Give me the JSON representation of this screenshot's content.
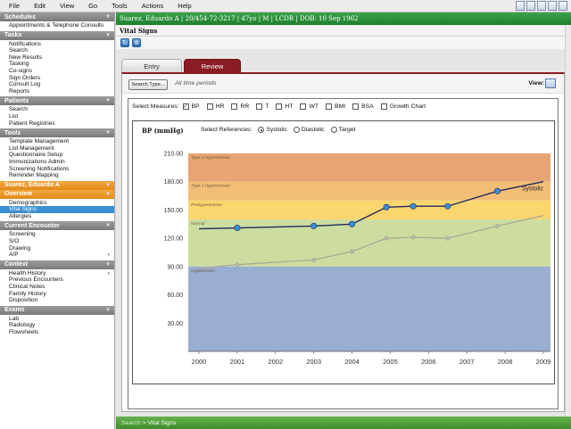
{
  "menubar": {
    "items": [
      "File",
      "Edit",
      "View",
      "Go",
      "Tools",
      "Actions",
      "Help"
    ],
    "right_icons": [
      "calendar-icon",
      "grid-icon",
      "print-icon",
      "list-icon",
      "window-icon"
    ]
  },
  "sidebar": {
    "sections": [
      {
        "title": "Schedules",
        "style": "gray",
        "items": [
          "Appointments & Telephone Consults"
        ]
      },
      {
        "title": "Tasks",
        "style": "gray",
        "items": [
          "Notifications",
          "Search",
          "New Results",
          "Tasking",
          "Co-signs",
          "Sign Orders",
          "Consult Log",
          "Reports"
        ]
      },
      {
        "title": "Patients",
        "style": "gray",
        "items": [
          "Search",
          "List",
          "Patient Registries"
        ]
      },
      {
        "title": "Tools",
        "style": "gray",
        "items": [
          "Template Management",
          "List Management",
          "Questionnaire Setup",
          "Immunizations Admin",
          "Screening Notifications",
          "Reminder Mapping"
        ]
      },
      {
        "title": "Suarez, Eduardo A",
        "style": "orange",
        "items": []
      },
      {
        "title": "Overview",
        "style": "orange",
        "items": [
          "Demographics",
          "Vital Signs",
          "Allergies"
        ],
        "selected": "Vital Signs"
      },
      {
        "title": "Current Encounter",
        "style": "gray",
        "items": [
          "Screening",
          "S/O",
          "Drawing",
          "A/P"
        ],
        "submenu": [
          "A/P"
        ]
      },
      {
        "title": "Context",
        "style": "gray",
        "items": [
          "Health History",
          "Previous Encounters",
          "Clinical Notes",
          "Family History",
          "Disposition"
        ],
        "submenu": [
          "Health History"
        ]
      },
      {
        "title": "Exams",
        "style": "gray",
        "items": [
          "Lab",
          "Radiology",
          "Flowsheets"
        ]
      }
    ]
  },
  "patient_bar": "Suarez, Eduardo A | 20/454-72-3217 | 47yo | M | LCDR | DOB: 10 Sep 1962",
  "subhead": "Vital Signs",
  "tabs": {
    "entry": "Entry",
    "review": "Review"
  },
  "filter": {
    "search_type": "Search Type...",
    "period": "All time periods",
    "view_label": "View:"
  },
  "measures": {
    "label": "Select Measures:",
    "options": [
      {
        "label": "BP",
        "checked": true
      },
      {
        "label": "HR",
        "checked": false
      },
      {
        "label": "RR",
        "checked": false
      },
      {
        "label": "T",
        "checked": false
      },
      {
        "label": "HT",
        "checked": false
      },
      {
        "label": "WT",
        "checked": false
      },
      {
        "label": "BMI",
        "checked": false
      },
      {
        "label": "BSA",
        "checked": false
      },
      {
        "label": "Growth Chart",
        "checked": false
      }
    ]
  },
  "references": {
    "label": "Select References:",
    "options": [
      {
        "label": "Systolic",
        "selected": true
      },
      {
        "label": "Diastolic",
        "selected": false
      },
      {
        "label": "Target",
        "selected": false
      }
    ]
  },
  "chart_data": {
    "type": "line",
    "title": "BP (mmHg)",
    "xlim": [
      2000,
      2009
    ],
    "ylim": [
      0,
      210
    ],
    "x_ticks": [
      "2000",
      "2001",
      "2002",
      "2003",
      "2004",
      "2005",
      "2006",
      "2007",
      "2008",
      "2009"
    ],
    "y_ticks": [
      "210.00",
      "180.00",
      "150.00",
      "120.00",
      "90.00",
      "60.00",
      "30.00"
    ],
    "bands": [
      {
        "label": "Type 2 Hypertension",
        "from": 180,
        "to": 210,
        "color": "#e8a474"
      },
      {
        "label": "Type 1 Hypertension",
        "from": 160,
        "to": 180,
        "color": "#f2be77"
      },
      {
        "label": "Prehypertension",
        "from": 140,
        "to": 160,
        "color": "#fbd56e"
      },
      {
        "label": "Normal",
        "from": 90,
        "to": 140,
        "color": "#cddda0"
      },
      {
        "label": "Hypotension",
        "from": 0,
        "to": 90,
        "color": "#9aaed1"
      }
    ],
    "series": [
      {
        "name": "Systolic",
        "color": "#1f2a5c",
        "x": [
          2000,
          2001,
          2003,
          2004,
          2004.9,
          2005.6,
          2006.5,
          2007.8,
          2009
        ],
        "y": [
          130,
          131,
          133,
          135,
          153,
          154,
          154,
          170,
          180
        ]
      },
      {
        "color": "#a6a697",
        "x": [
          2000,
          2001,
          2003,
          2004,
          2004.9,
          2005.6,
          2006.5,
          2007.8,
          2009
        ],
        "y": [
          88,
          92,
          97,
          106,
          120,
          121,
          120,
          133,
          144
        ]
      }
    ]
  },
  "statusbar": {
    "crumb_root": "Search",
    "crumb_current": "> Vital Signs"
  }
}
